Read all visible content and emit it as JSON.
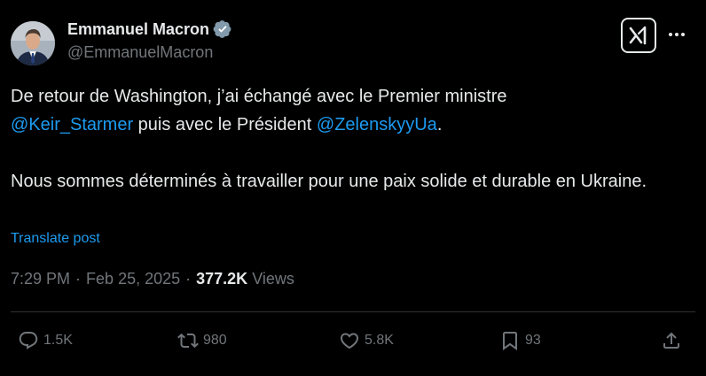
{
  "author": {
    "display_name": "Emmanuel Macron",
    "handle": "@EmmanuelMacron",
    "verified_icon": "verified-badge-icon",
    "verified_color": "#829aab"
  },
  "tweet": {
    "line1": "De retour de Washington, j’ai échangé avec le Premier ministre",
    "mention1": "@Keir_Starmer",
    "line2_mid": " puis avec le Président ",
    "mention2": "@ZelenskyyUa",
    "line2_end": ".",
    "paragraph2": "Nous sommes déterminés à travailler pour une paix solide et durable en Ukraine."
  },
  "translate_label": "Translate post",
  "meta": {
    "time": "7:29 PM",
    "dot1": "·",
    "date": "Feb 25, 2025",
    "dot2": "·",
    "views_count": "377.2K",
    "views_label": "Views"
  },
  "actions": {
    "replies": "1.5K",
    "reposts": "980",
    "likes": "5.8K",
    "bookmarks": "93"
  },
  "colors": {
    "background": "#000000",
    "text": "#e7e9ea",
    "secondary": "#71767b",
    "link": "#1d9bf0",
    "divider": "#2f3336"
  }
}
